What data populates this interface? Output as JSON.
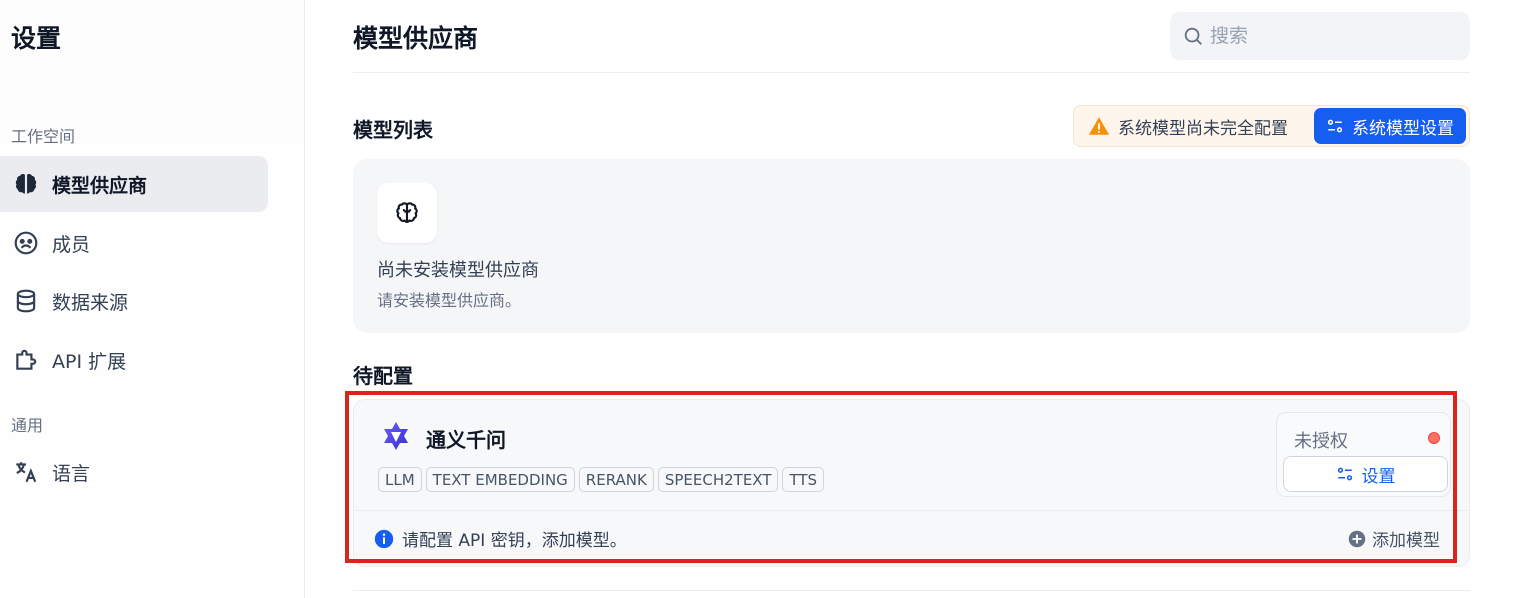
{
  "sidebar": {
    "title": "设置",
    "sections": [
      {
        "label": "工作空间"
      },
      {
        "label": "通用"
      }
    ],
    "items": [
      {
        "label": "模型供应商",
        "icon": "brain-icon",
        "active": true
      },
      {
        "label": "成员",
        "icon": "members-icon",
        "active": false
      },
      {
        "label": "数据来源",
        "icon": "database-icon",
        "active": false
      },
      {
        "label": "API 扩展",
        "icon": "puzzle-icon",
        "active": false
      },
      {
        "label": "语言",
        "icon": "translate-icon",
        "active": false
      }
    ]
  },
  "header": {
    "title": "模型供应商",
    "search_placeholder": "搜索"
  },
  "model_list": {
    "heading": "模型列表",
    "warning_text": "系统模型尚未完全配置",
    "system_settings_label": "系统模型设置",
    "empty_title": "尚未安装模型供应商",
    "empty_desc": "请安装模型供应商。"
  },
  "pending": {
    "heading": "待配置",
    "provider": {
      "name": "通义千问",
      "tags": [
        "LLM",
        "TEXT EMBEDDING",
        "RERANK",
        "SPEECH2TEXT",
        "TTS"
      ],
      "status": "未授权",
      "setup_label": "设置",
      "hint": "请配置 API 密钥，添加模型。",
      "add_model_label": "添加模型"
    }
  },
  "colors": {
    "primary": "#155eef",
    "warning": "#f79009",
    "status_unauthorized": "#f97066",
    "highlight": "#d9251c"
  }
}
